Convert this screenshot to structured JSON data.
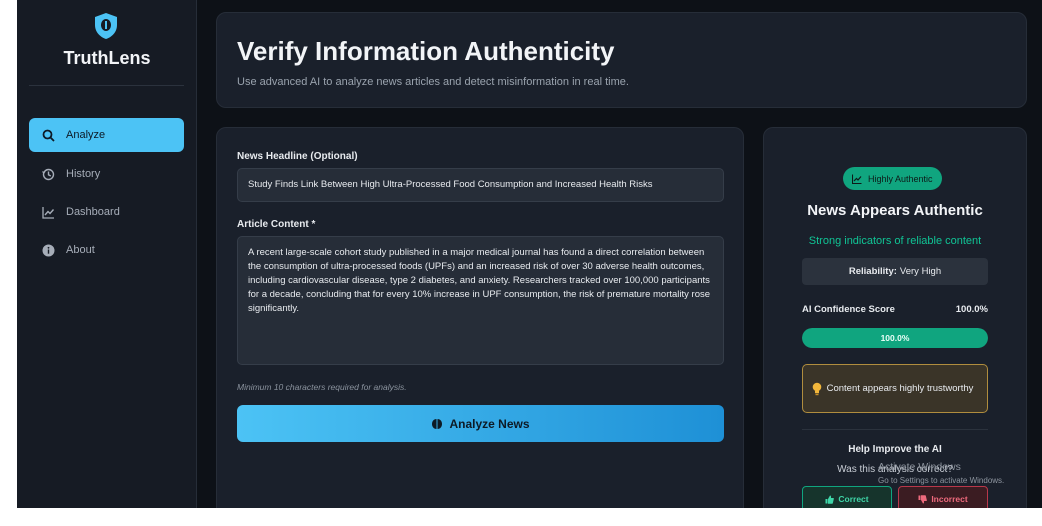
{
  "app": {
    "name": "TruthLens",
    "logo_icon": "shield-icon"
  },
  "sidebar": {
    "items": [
      {
        "label": "Analyze",
        "icon": "search-icon",
        "active": true
      },
      {
        "label": "History",
        "icon": "history-icon",
        "active": false
      },
      {
        "label": "Dashboard",
        "icon": "chart-line-icon",
        "active": false
      },
      {
        "label": "About",
        "icon": "info-icon",
        "active": false
      }
    ]
  },
  "header": {
    "title": "Verify Information Authenticity",
    "subtitle": "Use advanced AI to analyze news articles and detect misinformation in real time."
  },
  "form": {
    "headline_label": "News Headline (Optional)",
    "headline_value": "Study Finds Link Between High Ultra-Processed Food Consumption and Increased Health Risks",
    "content_label": "Article Content *",
    "content_value": "A recent large-scale cohort study published in a major medical journal has found a direct correlation between the consumption of ultra-processed foods (UPFs) and an increased risk of over 30 adverse health outcomes, including cardiovascular disease, type 2 diabetes, and anxiety. Researchers tracked over 100,000 participants for a decade, concluding that for every 10% increase in UPF consumption, the risk of premature mortality rose significantly.",
    "hint": "Minimum 10 characters required for analysis.",
    "analyze_label": "Analyze News"
  },
  "result": {
    "badge": "Highly Authentic",
    "title": "News Appears Authentic",
    "subtitle": "Strong indicators of reliable content",
    "reliability_label": "Reliability:",
    "reliability_value": "Very High",
    "confidence_label": "AI Confidence Score",
    "confidence_value": "100.0%",
    "confidence_fraction": 1.0,
    "insight": "Content appears highly trustworthy",
    "help_title": "Help Improve the AI",
    "help_question": "Was this analysis correct?",
    "correct_label": "Correct",
    "incorrect_label": "Incorrect"
  },
  "watermark": {
    "title": "Activate Windows",
    "subtitle": "Go to Settings to activate Windows."
  },
  "colors": {
    "accent": "#4cc3f5",
    "success": "#10a57f",
    "warning_border": "#b08d3e",
    "danger": "#b9374a",
    "background": "#0d1117",
    "card": "#1a202b"
  }
}
